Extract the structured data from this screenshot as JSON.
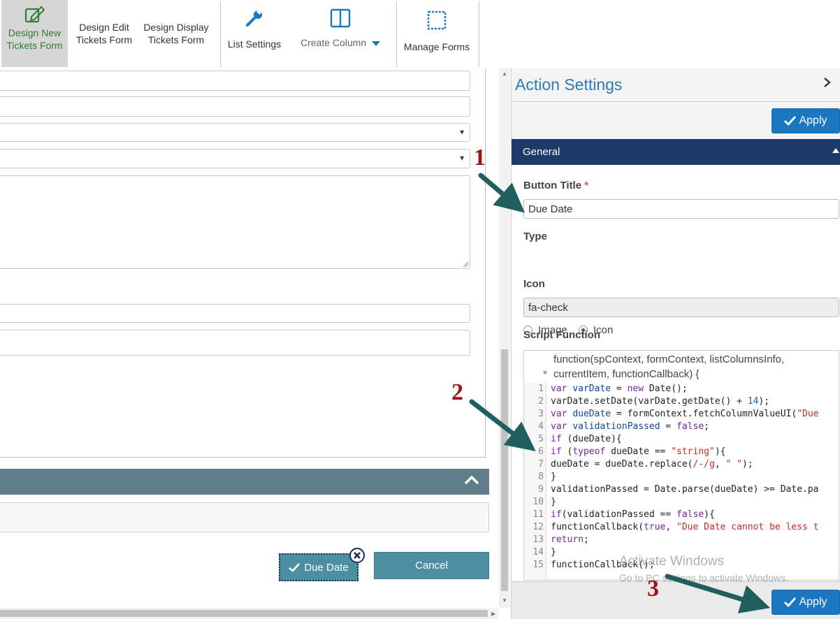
{
  "ribbon": {
    "design_new_line1": "Design New",
    "design_new_line2": "Tickets Form",
    "design_edit_line1": "Design Edit",
    "design_edit_line2": "Tickets Form",
    "design_display_line1": "Design Display",
    "design_display_line2": "Tickets Form",
    "list_settings": "List Settings",
    "create_column": "Create Column",
    "manage_forms": "Manage Forms"
  },
  "form": {
    "due_button": "Due Date",
    "cancel_button": "Cancel"
  },
  "panel": {
    "title": "Action Settings",
    "apply": "Apply",
    "section": "General",
    "button_title_label": "Button Title",
    "required_mark": "*",
    "button_title_value": "Due Date",
    "type_label": "Type",
    "type_options": [
      "Image",
      "Icon"
    ],
    "type_selected": "Icon",
    "icon_label": "Icon",
    "icon_value": "fa-check",
    "script_label": "Script Function",
    "script_header_line1": "function(spContext, formContext, listColumnsInfo,",
    "script_header_line2": "currentItem, functionCallback) {",
    "script_marker": "*",
    "line_numbers": [
      "1",
      "2",
      "3",
      "4",
      "5",
      "6",
      "7",
      "8",
      "9",
      "10",
      "11",
      "12",
      "13",
      "14",
      "15"
    ]
  },
  "watermark": {
    "line1": "Activate Windows",
    "line2": "Go to PC settings to activate Windows."
  },
  "annotations": [
    "1",
    "2",
    "3"
  ],
  "colors": {
    "accent_blue": "#1a78c2",
    "navy_bar": "#1e3a6b",
    "teal_button": "#4e8ea3",
    "slate_bar": "#607d8b",
    "annotation_red": "#a31212",
    "arrow_teal": "#1f5f5f"
  }
}
